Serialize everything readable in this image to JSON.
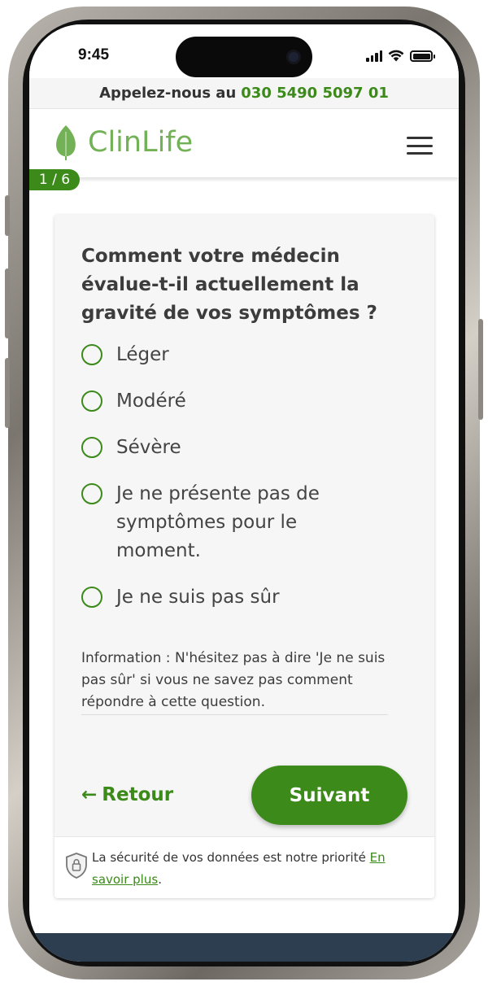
{
  "status": {
    "time": "9:45",
    "icons": [
      "signal-icon",
      "wifi-icon",
      "battery-icon"
    ]
  },
  "callbar": {
    "text": "Appelez-nous au",
    "phone": "030 5490 5097 01"
  },
  "header": {
    "brand": "ClinLife",
    "menu_icon": "hamburger-menu-icon"
  },
  "progress": {
    "label": "1 / 6"
  },
  "question": {
    "text": "Comment votre médecin évalue-t-il actuellement la gravité de vos symptômes ?",
    "options": [
      {
        "label": "Léger"
      },
      {
        "label": "Modéré"
      },
      {
        "label": "Sévère"
      },
      {
        "label": "Je ne présente pas de symptômes pour le moment."
      },
      {
        "label": "Je ne suis pas sûr"
      }
    ],
    "info": "Information : N'hésitez pas à dire 'Je ne suis pas sûr' si vous ne savez pas comment répondre à cette question."
  },
  "nav": {
    "back": "Retour",
    "next": "Suivant"
  },
  "security": {
    "text": "La sécurité de vos données est notre priorité",
    "link": "En savoir plus",
    "suffix": "."
  },
  "colors": {
    "accent": "#3b8a1a",
    "brand": "#72b155",
    "footer": "#2c3e50"
  }
}
